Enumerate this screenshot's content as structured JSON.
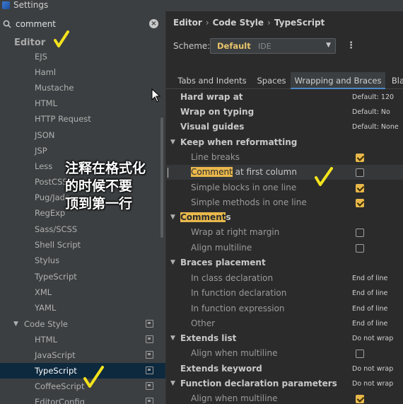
{
  "window": {
    "title": "Settings"
  },
  "search": {
    "value": "comment"
  },
  "tree": {
    "header": "Editor",
    "items": [
      "EJS",
      "Haml",
      "Mustache",
      "HTML",
      "HTTP Request",
      "JSON",
      "JSP",
      "Less",
      "PostCSS",
      "Pug/Jade",
      "RegExp",
      "Sass/SCSS",
      "Shell Script",
      "Stylus",
      "TypeScript",
      "XML",
      "YAML"
    ],
    "group": "Code Style",
    "group_items": [
      "HTML",
      "JavaScript",
      "TypeScript",
      "CoffeeScript",
      "EditorConfig"
    ],
    "selected": "TypeScript"
  },
  "annotation": {
    "line1": "注释在格式化",
    "line2": "的时候不要",
    "line3": "顶到第一行"
  },
  "breadcrumb": {
    "part1": "Editor",
    "part2": "Code Style",
    "part3": "TypeScript"
  },
  "scheme": {
    "label": "Scheme:",
    "value": "Default",
    "sub": "IDE"
  },
  "tabs": [
    "Tabs and Indents",
    "Spaces",
    "Wrapping and Braces",
    "Bla"
  ],
  "settings": {
    "hard_wrap": {
      "label": "Hard wrap at",
      "value": "Default: 120"
    },
    "wrap_typing": {
      "label": "Wrap on typing",
      "value": "Default: No"
    },
    "visual_guides": {
      "label": "Visual guides",
      "value": "Default: None"
    },
    "keep_reformat": {
      "label": "Keep when reformatting"
    },
    "line_breaks": {
      "label": "Line breaks"
    },
    "comment_first": {
      "label_hl": "Comment",
      "label_rest": " at first column"
    },
    "simple_blocks": {
      "label": "Simple blocks in one line"
    },
    "simple_methods": {
      "label": "Simple methods in one line"
    },
    "comments": {
      "label_hl": "Comment",
      "label_rest": "s"
    },
    "wrap_margin": {
      "label": "Wrap at right margin"
    },
    "align_multiline": {
      "label": "Align multiline"
    },
    "braces": {
      "label": "Braces placement"
    },
    "class_decl": {
      "label": "In class declaration",
      "value": "End of line"
    },
    "func_decl": {
      "label": "In function declaration",
      "value": "End of line"
    },
    "func_expr": {
      "label": "In function expression",
      "value": "End of line"
    },
    "other": {
      "label": "Other",
      "value": "End of line"
    },
    "extends_list": {
      "label": "Extends list",
      "value": "Do not wrap"
    },
    "extends_align": {
      "label": "Align when multiline"
    },
    "extends_kw": {
      "label": "Extends keyword",
      "value": "Do not wrap"
    },
    "func_params": {
      "label": "Function declaration parameters",
      "value": "Do not wrap"
    },
    "params_align": {
      "label": "Align when multiline"
    }
  },
  "colors": {
    "highlight": "#e9b84c",
    "selection": "#0d293e",
    "tab_underline": "#4a88c7"
  }
}
